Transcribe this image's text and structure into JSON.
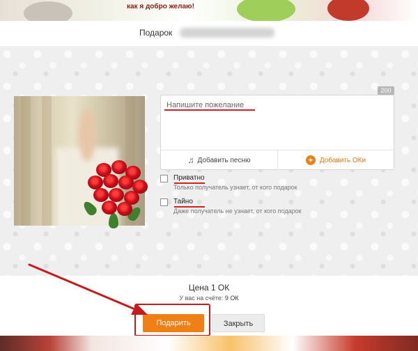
{
  "background": {
    "top_text": "как я добро желаю!"
  },
  "modal": {
    "title": "Подарок",
    "recipient_blurred": "••••••••••••••••••"
  },
  "wish": {
    "placeholder": "Напишите пожелание",
    "counter": "200",
    "add_song_label": "Добавить песню",
    "add_ok_label": "Добавить ОКи"
  },
  "options": [
    {
      "title": "Приватно",
      "subtitle": "Только получатель узнает, от кого подарок"
    },
    {
      "title": "Тайно",
      "subtitle": "Даже получатель не узнает, от кого подарок"
    }
  ],
  "footer": {
    "price_label": "Цена 1 ОК",
    "balance_prefix": "У вас на счёте:",
    "balance_value": "9 ОК",
    "gift_button": "Подарить",
    "close_button": "Закрыть"
  },
  "colors": {
    "accent_orange": "#f07f15",
    "annotation_red": "#c81a1a"
  },
  "icons": {
    "song": "music-note-icon",
    "ok": "ok-coin-icon"
  }
}
